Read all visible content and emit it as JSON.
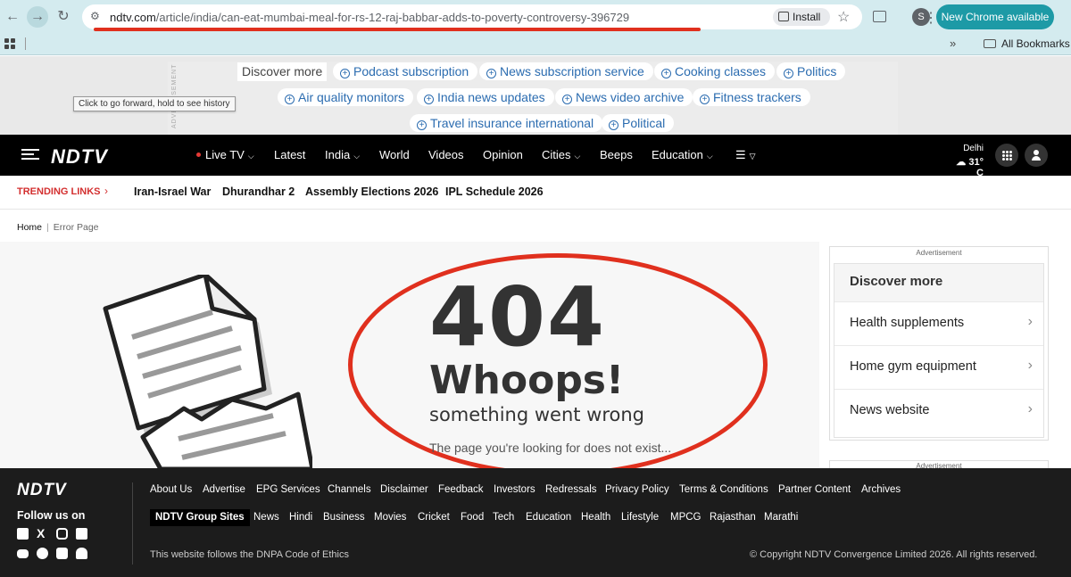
{
  "browser": {
    "url_host": "ndtv.com",
    "url_path": "/article/india/can-eat-mumbai-meal-for-rs-12-raj-babbar-adds-to-poverty-controversy-396729",
    "install_label": "Install",
    "profile_initial": "S",
    "update_label": "New Chrome available",
    "bookmarks_label": "All Bookmarks",
    "bookmarks_chevron": "»",
    "tooltip": "Click to go forward, hold to see history"
  },
  "ad_band": {
    "vertical_label": "ADVERTISEMENT",
    "discover_label": "Discover more",
    "pills": [
      "Podcast subscription",
      "News subscription service",
      "Cooking classes",
      "Politics",
      "Air quality monitors",
      "India news updates",
      "News video archive",
      "Fitness trackers",
      "Travel insurance international",
      "Political"
    ]
  },
  "nav": {
    "logo": "NDTV",
    "items": [
      "Live TV",
      "Latest",
      "India",
      "World",
      "Videos",
      "Opinion",
      "Cities",
      "Beeps",
      "Education"
    ],
    "weather_city": "Delhi",
    "weather_temp": "31° C"
  },
  "trending": {
    "label": "TRENDING LINKS",
    "links": [
      "Iran-Israel War",
      "Dhurandhar 2",
      "Assembly Elections 2026",
      "IPL Schedule 2026"
    ]
  },
  "breadcrumb": {
    "home": "Home",
    "current": "Error Page"
  },
  "error": {
    "code": "404",
    "title": "Whoops!",
    "subtitle": "something went wrong",
    "message": "The page you're looking for does not exist..."
  },
  "sidebar": {
    "ad_label": "Advertisement",
    "heading": "Discover more",
    "items": [
      "Health supplements",
      "Home gym equipment",
      "News website"
    ],
    "ad_label2": "Advertisement"
  },
  "footer": {
    "logo": "NDTV",
    "follow": "Follow us on",
    "row1": [
      "About Us",
      "Advertise",
      "EPG Services",
      "Channels",
      "Disclaimer",
      "Feedback",
      "Investors",
      "Redressals",
      "Privacy Policy",
      "Terms & Conditions",
      "Partner Content",
      "Archives"
    ],
    "group": "NDTV Group Sites",
    "row2": [
      "News",
      "Hindi",
      "Business",
      "Movies",
      "Cricket",
      "Food",
      "Tech",
      "Education",
      "Health",
      "Lifestyle",
      "MPCG",
      "Rajasthan",
      "Marathi"
    ],
    "dnpa": "This website follows the DNPA Code of Ethics",
    "copyright": "© Copyright NDTV Convergence Limited 2026. All rights reserved."
  },
  "colors": {
    "annotation_red": "#e0301e",
    "brand_black": "#000000",
    "link_blue": "#2b6cb0"
  }
}
